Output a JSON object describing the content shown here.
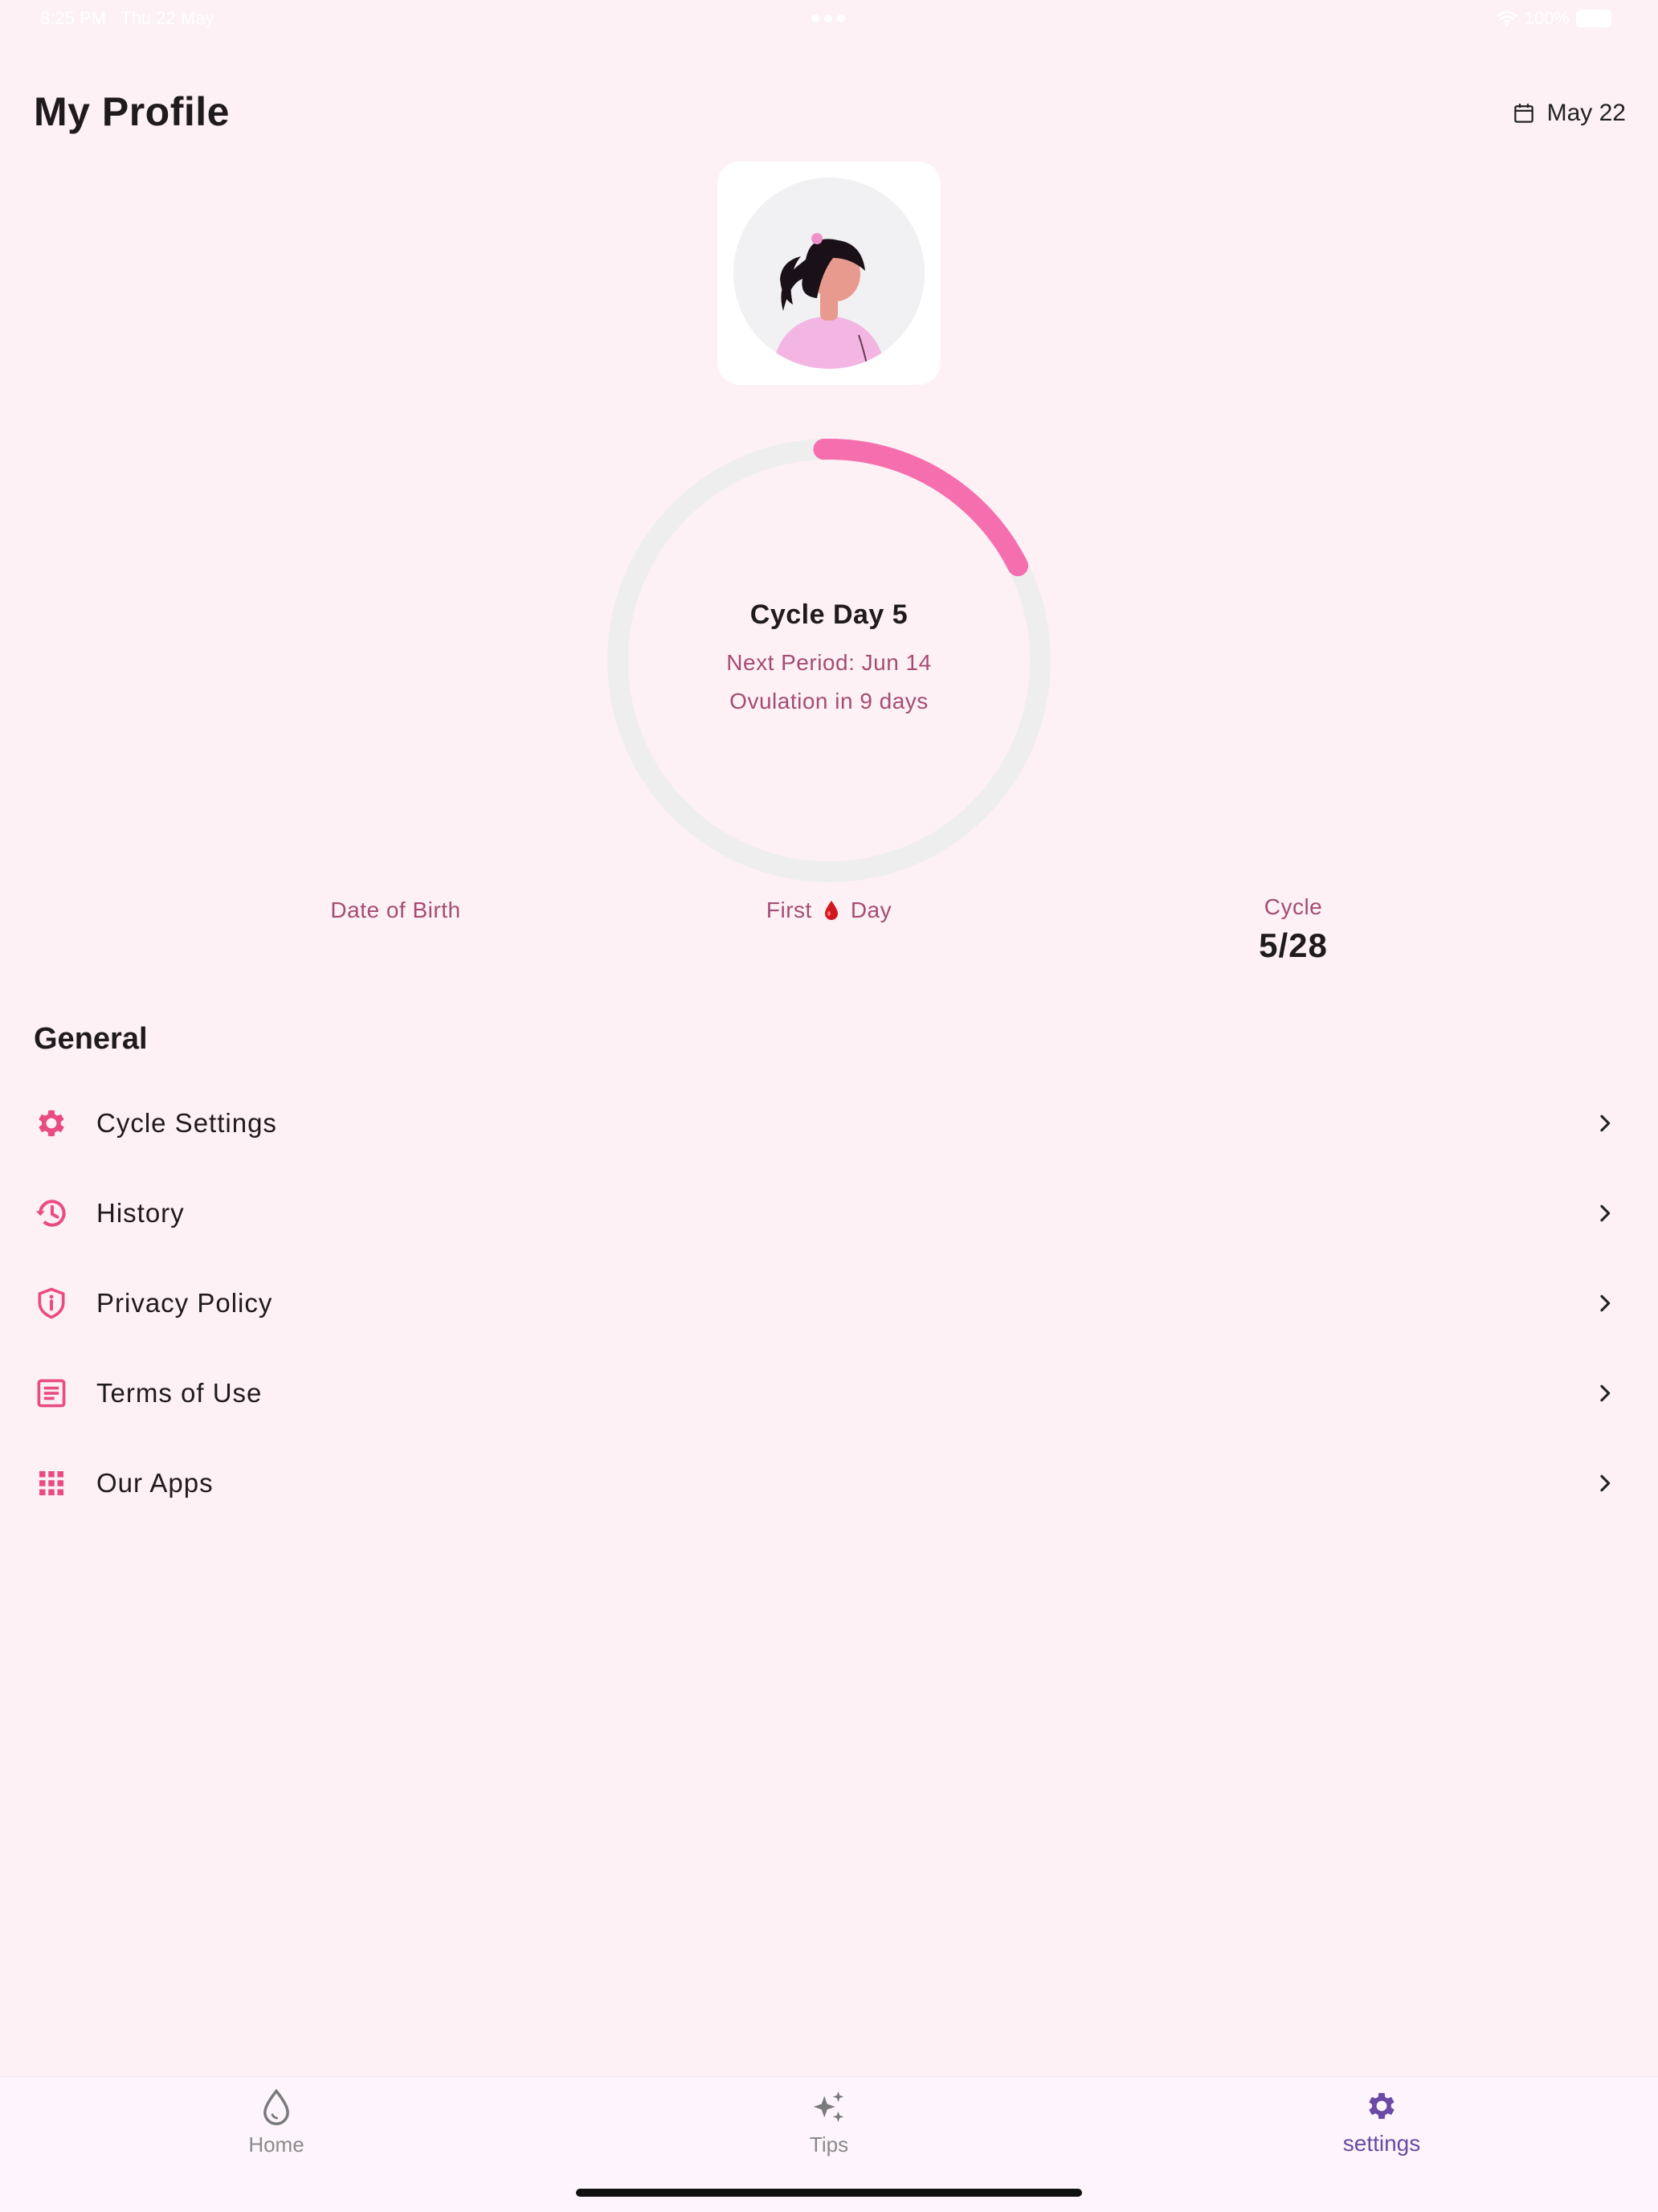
{
  "status_bar": {
    "time": "8:25 PM",
    "date": "Thu 22 May",
    "battery": "100%"
  },
  "header": {
    "title": "My Profile",
    "date_label": "May 22"
  },
  "cycle": {
    "title": "Cycle Day 5",
    "next_period": "Next Period: Jun 14",
    "ovulation": "Ovulation in 9 days",
    "progress_fraction": 0.18
  },
  "stats": {
    "dob_label": "Date of Birth",
    "first_label_a": "First",
    "first_label_b": "Day",
    "cycle_label": "Cycle",
    "cycle_value": "5/28"
  },
  "general": {
    "title": "General",
    "items": [
      {
        "label": "Cycle Settings",
        "icon": "gear-icon"
      },
      {
        "label": "History",
        "icon": "history-icon"
      },
      {
        "label": "Privacy Policy",
        "icon": "shield-info-icon"
      },
      {
        "label": "Terms of Use",
        "icon": "document-icon"
      },
      {
        "label": "Our Apps",
        "icon": "grid-icon"
      }
    ]
  },
  "nav": {
    "home": "Home",
    "tips": "Tips",
    "settings": "settings"
  },
  "colors": {
    "background": "#fdf1f5",
    "accent_pink": "#f56fae",
    "icon_pink": "#e94b83",
    "label_mauve": "#a44d74",
    "nav_active": "#6a4aa5",
    "nav_inactive": "#8a8a8a"
  }
}
